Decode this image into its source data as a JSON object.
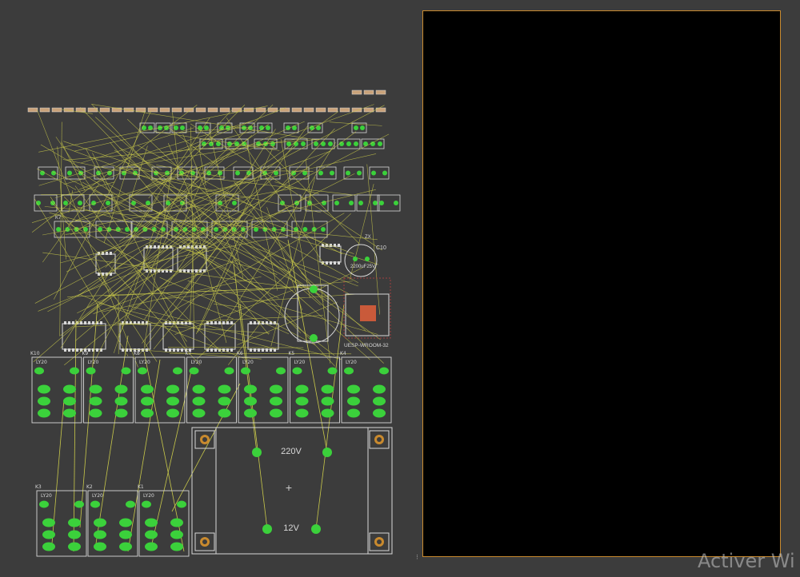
{
  "schematic": {
    "relays_top": [
      {
        "ref": "K10",
        "type": "LY20"
      },
      {
        "ref": "K9",
        "type": "LY20"
      },
      {
        "ref": "K8",
        "type": "LY20"
      },
      {
        "ref": "K7",
        "type": "LY20"
      },
      {
        "ref": "K6",
        "type": "LY20"
      },
      {
        "ref": "K5",
        "type": "LY20"
      },
      {
        "ref": "K4",
        "type": "LY20"
      }
    ],
    "relays_bottom": [
      {
        "ref": "K3",
        "type": "LY20"
      },
      {
        "ref": "K2",
        "type": "LY20"
      },
      {
        "ref": "K1",
        "type": "LY20"
      }
    ],
    "transformer": {
      "primary": "220V",
      "secondary": "12V"
    },
    "capacitor": {
      "ref": "C10",
      "value": "2200uF25V"
    },
    "module_label": "UESP-WROOM-32",
    "row_label_k7": "K7",
    "zx_label": "ZX"
  },
  "watermark": "Activer Wi",
  "colors": {
    "background": "#3c3c3c",
    "ratsnest": "#c8c84a",
    "pad": "#3bd13b",
    "outline": "#d8d8d8",
    "board": "#000000",
    "board_border": "#c98a2e"
  }
}
